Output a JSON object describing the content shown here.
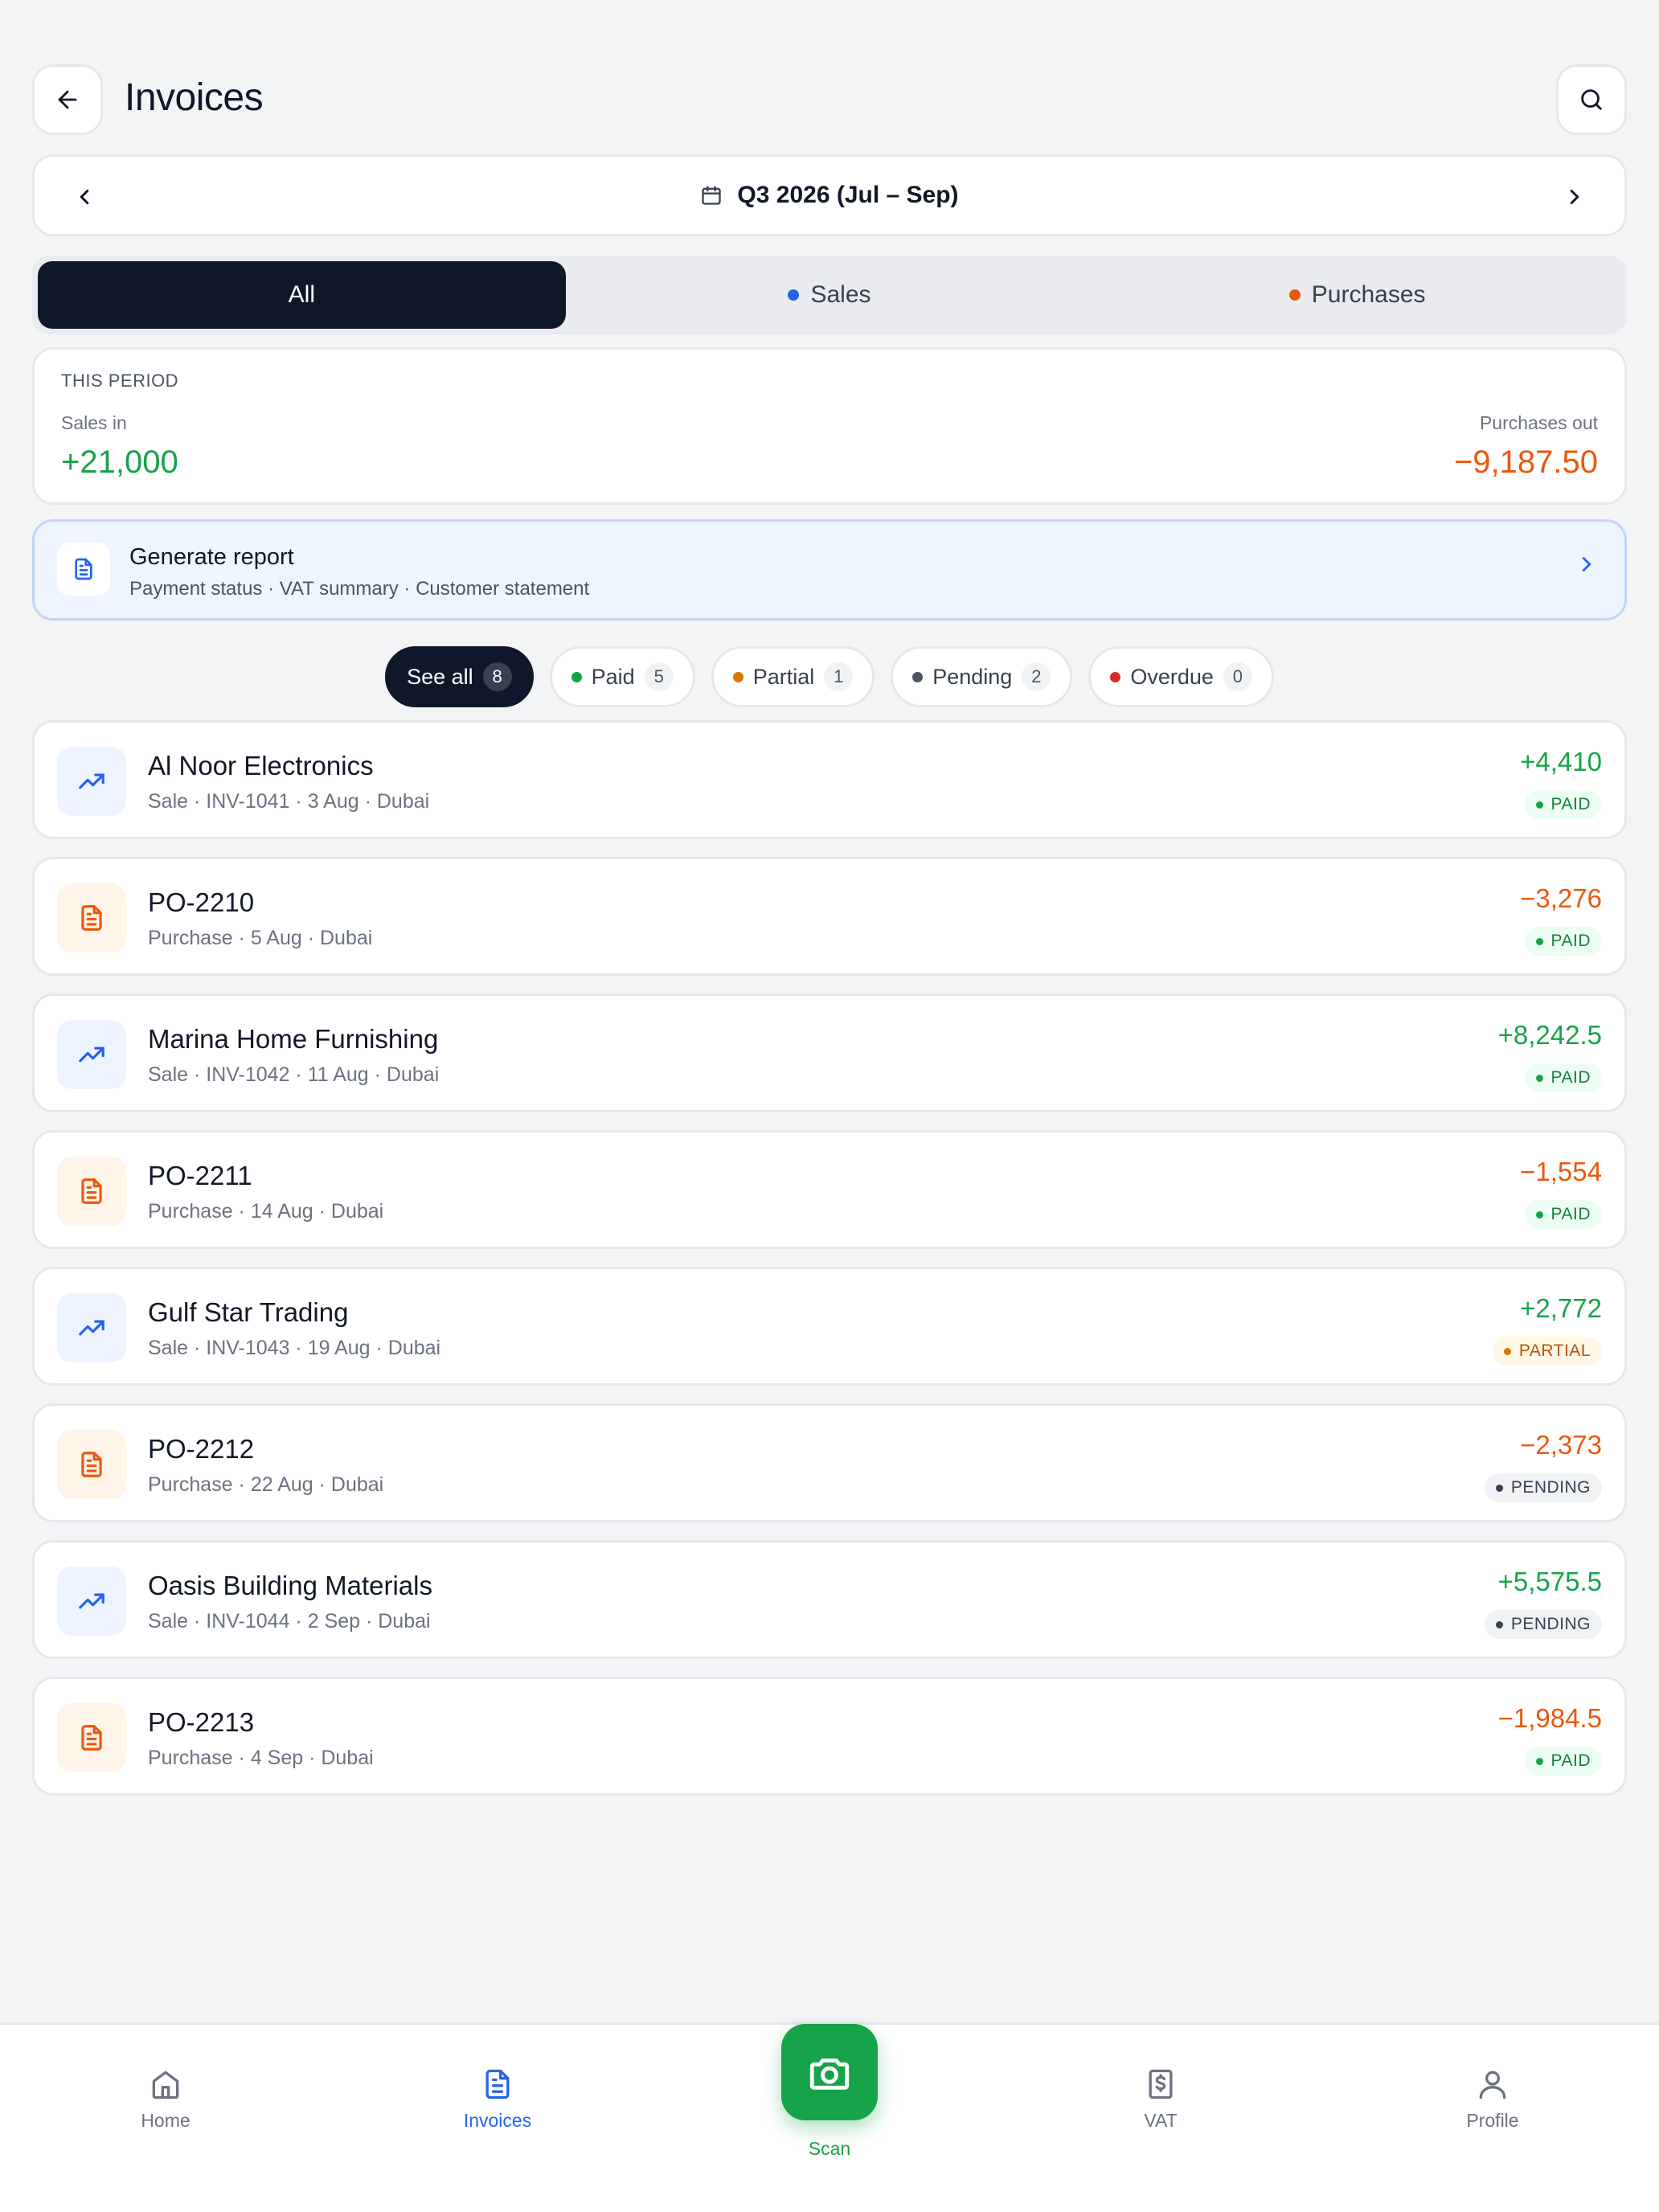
{
  "header": {
    "title": "Invoices"
  },
  "period": {
    "label": "Q3 2026 (Jul – Sep)"
  },
  "tabs": [
    {
      "label": "All",
      "dot": null
    },
    {
      "label": "Sales",
      "dot": "#2563eb"
    },
    {
      "label": "Purchases",
      "dot": "#ea580c"
    }
  ],
  "summary": {
    "heading": "THIS PERIOD",
    "sales_label": "Sales in",
    "sales_value": "+21,000",
    "purchases_label": "Purchases out",
    "purchases_value": "−9,187.50"
  },
  "report": {
    "title": "Generate report",
    "subtitle": "Payment status · VAT summary · Customer statement"
  },
  "filters": [
    {
      "label": "See all",
      "count": "8",
      "dot": null
    },
    {
      "label": "Paid",
      "count": "5",
      "dot": "#16a34a"
    },
    {
      "label": "Partial",
      "count": "1",
      "dot": "#d97706"
    },
    {
      "label": "Pending",
      "count": "2",
      "dot": "#4b5563"
    },
    {
      "label": "Overdue",
      "count": "0",
      "dot": "#dc2626"
    }
  ],
  "invoices": [
    {
      "name": "Al Noor Electronics",
      "meta": "Sale · INV-1041 · 3 Aug · Dubai",
      "amount": "+4,410",
      "status": "PAID",
      "kind": "sale"
    },
    {
      "name": "PO-2210",
      "meta": "Purchase · 5 Aug · Dubai",
      "amount": "−3,276",
      "status": "PAID",
      "kind": "purchase"
    },
    {
      "name": "Marina Home Furnishing",
      "meta": "Sale · INV-1042 · 11 Aug · Dubai",
      "amount": "+8,242.5",
      "status": "PAID",
      "kind": "sale"
    },
    {
      "name": "PO-2211",
      "meta": "Purchase · 14 Aug · Dubai",
      "amount": "−1,554",
      "status": "PAID",
      "kind": "purchase"
    },
    {
      "name": "Gulf Star Trading",
      "meta": "Sale · INV-1043 · 19 Aug · Dubai",
      "amount": "+2,772",
      "status": "PARTIAL",
      "kind": "sale"
    },
    {
      "name": "PO-2212",
      "meta": "Purchase · 22 Aug · Dubai",
      "amount": "−2,373",
      "status": "PENDING",
      "kind": "purchase"
    },
    {
      "name": "Oasis Building Materials",
      "meta": "Sale · INV-1044 · 2 Sep · Dubai",
      "amount": "+5,575.5",
      "status": "PENDING",
      "kind": "sale"
    },
    {
      "name": "PO-2213",
      "meta": "Purchase · 4 Sep · Dubai",
      "amount": "−1,984.5",
      "status": "PAID",
      "kind": "purchase"
    }
  ],
  "nav": {
    "home": "Home",
    "invoices": "Invoices",
    "scan": "Scan",
    "vat": "VAT",
    "profile": "Profile"
  },
  "colors": {
    "primary_dark": "#0f172a",
    "accent_blue": "#2563eb",
    "positive": "#16a34a",
    "negative": "#ea580c"
  },
  "icons": {
    "back": "arrow-left-icon",
    "search": "search-icon",
    "calendar": "calendar-icon",
    "report": "document-icon",
    "sale": "trending-up-icon",
    "purchase": "document-icon",
    "scan": "camera-icon"
  }
}
